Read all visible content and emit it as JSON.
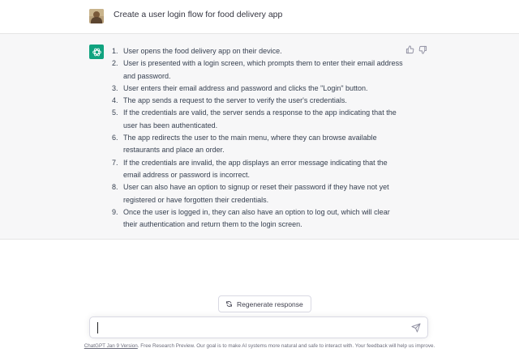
{
  "user_message": {
    "text": "Create a user login flow for food delivery app"
  },
  "assistant_message": {
    "items": [
      {
        "num": "1.",
        "text": "User opens the food delivery app on their device."
      },
      {
        "num": "2.",
        "text": "User is presented with a login screen, which prompts them to enter their email address and password."
      },
      {
        "num": "3.",
        "text": "User enters their email address and password and clicks the \"Login\" button."
      },
      {
        "num": "4.",
        "text": "The app sends a request to the server to verify the user's credentials."
      },
      {
        "num": "5.",
        "text": "If the credentials are valid, the server sends a response to the app indicating that the user has been authenticated."
      },
      {
        "num": "6.",
        "text": "The app redirects the user to the main menu, where they can browse available restaurants and place an order."
      },
      {
        "num": "7.",
        "text": "If the credentials are invalid, the app displays an error message indicating that the email address or password is incorrect."
      },
      {
        "num": "8.",
        "text": "User can also have an option to signup or reset their password if they have not yet registered or have forgotten their credentials."
      },
      {
        "num": "9.",
        "text": "Once the user is logged in, they can also have an option to log out, which will clear their authentication and return them to the login screen."
      }
    ]
  },
  "icons": {
    "user_avatar": "user-avatar-photo",
    "bot_avatar": "openai-logo-icon",
    "thumbs_up": "thumbs-up-icon",
    "thumbs_down": "thumbs-down-icon",
    "regenerate": "refresh-icon",
    "send": "paper-plane-icon"
  },
  "regenerate": {
    "label": "Regenerate response"
  },
  "composer": {
    "value": "",
    "placeholder": ""
  },
  "footer": {
    "version_link": "ChatGPT Jan 9 Version",
    "text": ". Free Research Preview. Our goal is to make AI systems more natural and safe to interact with. Your feedback will help us improve."
  },
  "colors": {
    "accent": "#10a37f",
    "assistant_bg": "#f7f7f8",
    "text": "#374151"
  }
}
